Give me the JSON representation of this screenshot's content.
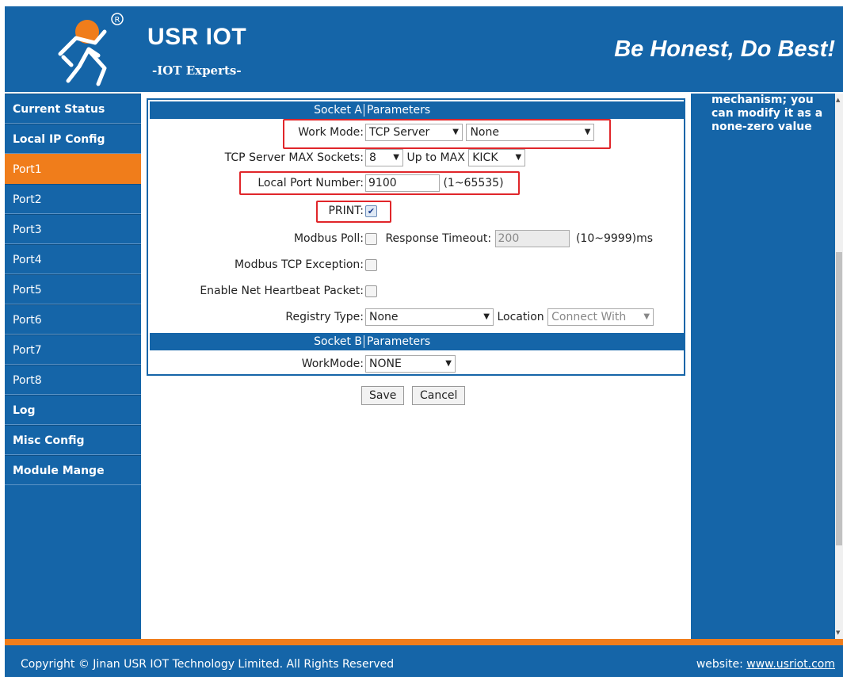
{
  "header": {
    "brand": "USR IOT",
    "brand_sub": "-IOT Experts-",
    "slogan": "Be Honest, Do Best!",
    "logo_icon": "usr-person-logo-icon",
    "registered_mark": "®"
  },
  "sidebar": {
    "items": [
      {
        "label": "Current Status"
      },
      {
        "label": "Local IP Config"
      },
      {
        "label": "Port1"
      },
      {
        "label": "Port2"
      },
      {
        "label": "Port3"
      },
      {
        "label": "Port4"
      },
      {
        "label": "Port5"
      },
      {
        "label": "Port6"
      },
      {
        "label": "Port7"
      },
      {
        "label": "Port8"
      },
      {
        "label": "Log"
      },
      {
        "label": "Misc Config"
      },
      {
        "label": "Module Mange"
      }
    ],
    "active": "Port1"
  },
  "form": {
    "socket_a": {
      "header_left": "Socket A",
      "header_right": "Parameters"
    },
    "work_mode": {
      "label": "Work Mode:",
      "mode_value": "TCP Server",
      "second_value": "None"
    },
    "max_sockets": {
      "label": "TCP Server MAX Sockets:",
      "value": "8",
      "upto_label": "Up to MAX",
      "upto_value": "KICK"
    },
    "local_port": {
      "label": "Local Port Number:",
      "value": "9100",
      "range": "(1~65535)"
    },
    "print": {
      "label": "PRINT:",
      "checked": true
    },
    "modbus_poll": {
      "label": "Modbus Poll:",
      "timeout_label": "Response Timeout:",
      "timeout_value": "200",
      "timeout_range": "(10~9999)ms"
    },
    "modbus_tcp_exception": {
      "label": "Modbus TCP Exception:"
    },
    "heartbeat": {
      "label": "Enable Net Heartbeat Packet:"
    },
    "registry": {
      "label": "Registry Type:",
      "value": "None",
      "location_label": "Location",
      "location_value": "Connect With"
    },
    "socket_b": {
      "header_left": "Socket B",
      "header_right": "Parameters"
    },
    "workmode_b": {
      "label": "WorkMode:",
      "value": "NONE"
    }
  },
  "buttons": {
    "save": "Save",
    "cancel": "Cancel"
  },
  "help": {
    "line1": "mechanism; you",
    "line2": "can modify it as a",
    "line3": "none-zero value"
  },
  "footer": {
    "copyright": "Copyright © Jinan USR IOT Technology Limited. All Rights Reserved",
    "website_label": "website:",
    "website_link": "www.usriot.com"
  },
  "colors": {
    "primary": "#1565a8",
    "accent": "#f07d1b",
    "highlight_box": "#e0262a"
  }
}
